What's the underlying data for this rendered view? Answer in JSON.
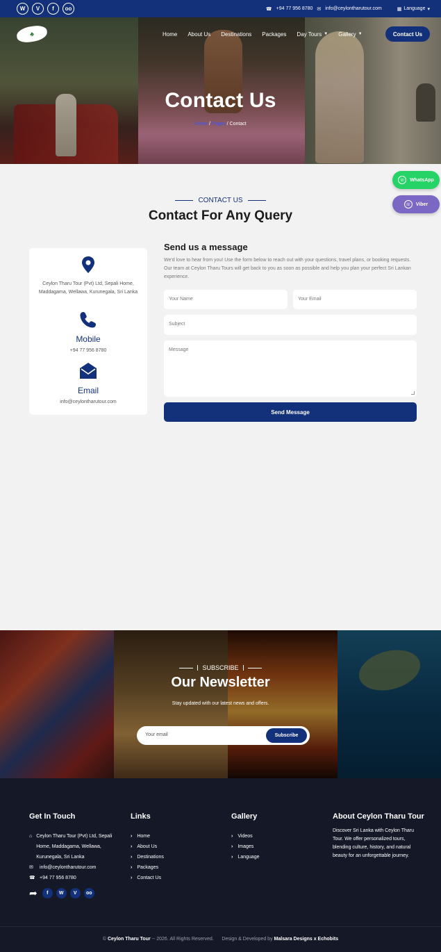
{
  "topbar": {
    "social": [
      {
        "icon": "whatsapp-icon",
        "glyph": "W"
      },
      {
        "icon": "viber-icon",
        "glyph": "V"
      },
      {
        "icon": "facebook-icon",
        "glyph": "f"
      },
      {
        "icon": "tripadvisor-icon",
        "glyph": "oo"
      }
    ],
    "phone": "+94 77 956 8780",
    "email": "info@ceylontharutour.com",
    "language": "Language"
  },
  "hero": {
    "logo_text": "Ceylon Tharu Tours",
    "nav": [
      {
        "label": "Home",
        "caret": false
      },
      {
        "label": "About Us",
        "caret": false
      },
      {
        "label": "Destinations",
        "caret": false
      },
      {
        "label": "Packages",
        "caret": false
      },
      {
        "label": "Day Tours",
        "caret": true
      },
      {
        "label": "Gallery",
        "caret": true
      }
    ],
    "cta": "Contact Us",
    "title": "Contact Us",
    "breadcrumb": [
      "Home",
      "Pages",
      "Contact"
    ]
  },
  "floating": {
    "whatsapp": "WhatsApp",
    "viber": "Viber"
  },
  "section": {
    "kicker": "CONTACT US",
    "title": "Contact For Any Query"
  },
  "info": {
    "address": "Ceylon Tharu Tour (Pvt) Ltd, Sepali Home, Maddagama, Wellawa, Kurunegala, Sri Lanka",
    "mobile_label": "Mobile",
    "mobile": "+94 77 956 8780",
    "email_label": "Email",
    "email": "info@ceylontharutour.com"
  },
  "form": {
    "title": "Send us a message",
    "description": "We'd love to hear from you! Use the form below to reach out with your questions, travel plans, or booking requests. Our team at Ceylon Tharu Tours will get back to you as soon as possible and help you plan your perfect Sri Lankan experience.",
    "name_placeholder": "Your Name",
    "email_placeholder": "Your Email",
    "subject_placeholder": "Subject",
    "message_placeholder": "Message",
    "submit": "Send Message"
  },
  "newsletter": {
    "kicker": "SUBSCRIBE",
    "title": "Our Newsletter",
    "subtitle": "Stay updated with our latest news and offers.",
    "placeholder": "Your email",
    "button": "Subscribe"
  },
  "footer": {
    "touch_title": "Get In Touch",
    "address": "Ceylon Tharu Tour (Pvt) Ltd, Sepali Home, Maddagama, Wellawa, Kurunegala, Sri Lanka",
    "email": "info@ceylontharutour.com",
    "phone": "+94 77 956 8780",
    "links_title": "Links",
    "links": [
      "Home",
      "About Us",
      "Destinations",
      "Packages",
      "Contact Us"
    ],
    "gallery_title": "Gallery",
    "gallery": [
      "Videos",
      "Images",
      "Language"
    ],
    "about_title": "About Ceylon Tharu Tour",
    "about_text": "Discover Sri Lanka with Ceylon Tharu Tour. We offer personalized tours, blending culture, history, and natural beauty for an unforgettable journey.",
    "copyright_brand": "Ceylon Tharu Tour",
    "copyright_text": " -- 2026. All Rights Reserved.",
    "credit_text": "Design & Developed by ",
    "credit_brand": "Malsara Designs x Echobits"
  },
  "colors": {
    "brand": "#13307a",
    "whatsapp": "#25d366",
    "viber": "#7b68c4",
    "footer_bg": "#141827"
  }
}
